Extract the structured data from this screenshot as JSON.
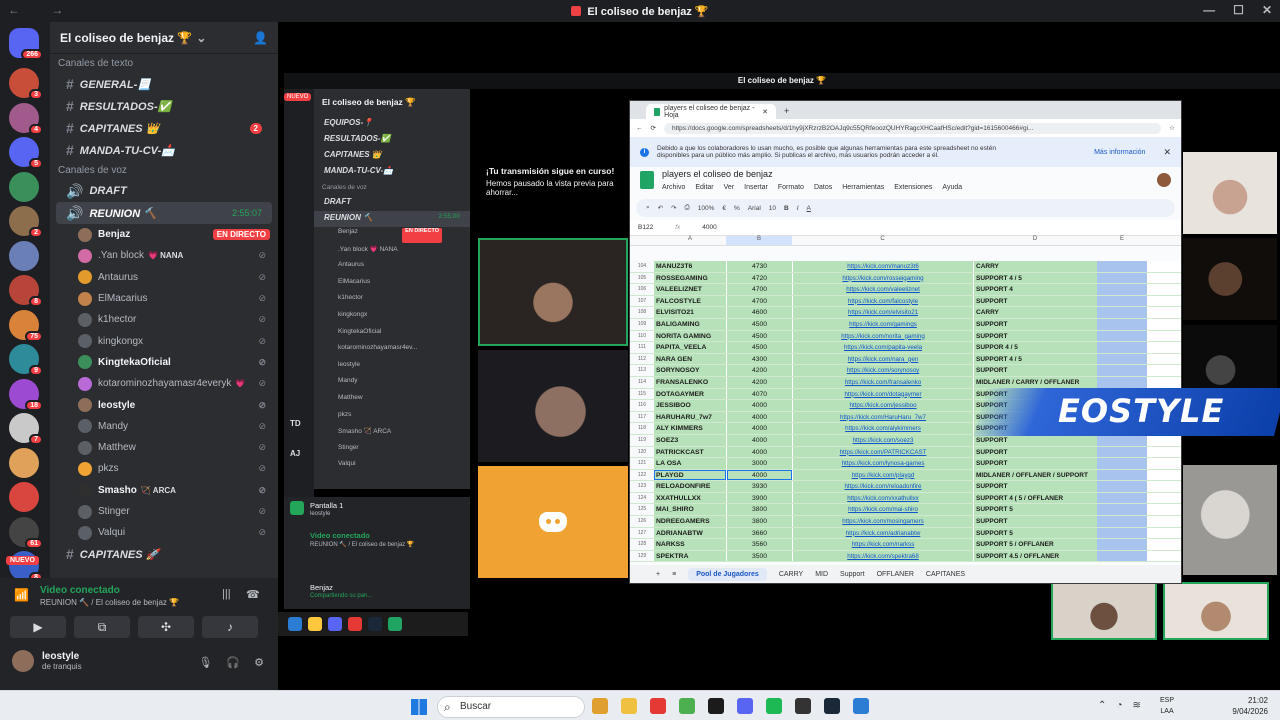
{
  "window": {
    "title": "El coliseo de benjaz 🏆",
    "controls": [
      "—",
      "☐",
      "✕"
    ]
  },
  "rail": {
    "mention_badge": "266",
    "new_badge": "NUEVO",
    "servers": [
      {
        "color": "#c94e3a",
        "badge": "3"
      },
      {
        "color": "#a05a8c",
        "badge": "4"
      },
      {
        "color": "#5865f2",
        "badge": "5"
      },
      {
        "color": "#3b8f5a",
        "badge": ""
      },
      {
        "color": "#8c6e4d",
        "badge": "2"
      },
      {
        "color": "#6a7fb5",
        "badge": ""
      },
      {
        "color": "#b8453a",
        "badge": "8"
      },
      {
        "color": "#d9833a",
        "badge": "75"
      },
      {
        "color": "#2e8b9a",
        "badge": "9"
      },
      {
        "color": "#9b4ad1",
        "badge": "18"
      },
      {
        "color": "#c9c9c9",
        "badge": "7"
      },
      {
        "color": "#e0a25a",
        "badge": ""
      },
      {
        "color": "#d9453f",
        "badge": ""
      },
      {
        "color": "#444",
        "badge": "61"
      },
      {
        "color": "#3a5fc7",
        "badge": "8"
      }
    ]
  },
  "sidebar": {
    "guild_name": "El coliseo de benjaz 🏆",
    "text_category": "Canales de texto",
    "text_channels": [
      {
        "name": "GENERAL-📃",
        "count": ""
      },
      {
        "name": "RESULTADOS-✅",
        "count": ""
      },
      {
        "name": "CAPITANES 👑",
        "count": "2"
      },
      {
        "name": "MANDA-TU-CV-📩",
        "count": ""
      }
    ],
    "voice_category": "Canales de voz",
    "voice_channels": [
      {
        "name": "DRAFT",
        "timer": ""
      },
      {
        "name": "REUNION 🔨",
        "timer": "2:55:07"
      }
    ],
    "voice_users": [
      {
        "name": "Benjaz",
        "tag": "",
        "live": "EN DIRECTO",
        "color": "#8e6e5b",
        "bright": true
      },
      {
        "name": ".Yan block",
        "tag": "💗 NANA",
        "live": "",
        "color": "#d26aa6",
        "bright": false
      },
      {
        "name": "Antaurus",
        "tag": "",
        "live": "",
        "color": "#e29b2b",
        "bright": false
      },
      {
        "name": "ElMacarius",
        "tag": "",
        "live": "",
        "color": "#c1824b",
        "bright": false
      },
      {
        "name": "k1hector",
        "tag": "",
        "live": "",
        "color": "#5b5f66",
        "bright": false
      },
      {
        "name": "kingkongx",
        "tag": "",
        "live": "",
        "color": "#5b5f66",
        "bright": false
      },
      {
        "name": "KingtekaOficial",
        "tag": "",
        "live": "",
        "color": "#3b8f5a",
        "bright": true
      },
      {
        "name": "kotarominozhayamasr4everyk",
        "tag": "💗",
        "live": "",
        "color": "#b86ad6",
        "bright": false
      },
      {
        "name": "leostyle",
        "tag": "",
        "live": "",
        "color": "#8e6e5b",
        "bright": true
      },
      {
        "name": "Mandy",
        "tag": "",
        "live": "",
        "color": "#5b5f66",
        "bright": false
      },
      {
        "name": "Matthew",
        "tag": "",
        "live": "",
        "color": "#5b5f66",
        "bright": false
      },
      {
        "name": "pkzs",
        "tag": "",
        "live": "",
        "color": "#f0a232",
        "bright": false
      },
      {
        "name": "Smasho",
        "tag": "🏹 ARCA",
        "live": "",
        "color": "#2f2f2f",
        "bright": true
      },
      {
        "name": "Stinger",
        "tag": "",
        "live": "",
        "color": "#5b5f66",
        "bright": false
      },
      {
        "name": "Valqui",
        "tag": "",
        "live": "",
        "color": "#5b5f66",
        "bright": false
      }
    ],
    "bottom_channel": "CAPITANES 🚀"
  },
  "voicebar": {
    "status": "Video conectado",
    "location": "REUNION 🔨 / El coliseo de benjaz 🏆",
    "username": "leostyle",
    "user_status": "de tranquis"
  },
  "stream": {
    "inner_title": "El coliseo de benjaz 🏆",
    "inner_msg_title": "¡Tu transmisión sigue en curso!",
    "inner_msg_body": "Hemos pausado la vista previa para ahorrar...",
    "inner_guild": "El coliseo de benjaz 🏆",
    "inner_channels": [
      "EQUIPOS-📍",
      "RESULTADOS-✅",
      "CAPITANES 👑",
      "MANDA-TU-CV-📩"
    ],
    "inner_new": "NUEVO",
    "inner_voice_cat": "Canales de voz",
    "inner_voice_channels": [
      "DRAFT",
      "REUNION 🔨"
    ],
    "inner_timer": "2:55:00",
    "inner_users": [
      "Benjaz",
      ".Yan block 💗 NANA",
      "Antaurus",
      "ElMacarius",
      "k1hector",
      "kingkongx",
      "KingtekaOficial",
      "kotarominozhayamasr4ev...",
      "leostyle",
      "Mandy",
      "Matthew",
      "pkzs",
      "Smasho 🏹 ARCA",
      "Stinger",
      "Valqui"
    ],
    "inner_live": "EN DIRECTO",
    "inner_screen": "Pantalla 1",
    "inner_screen_sub": "leostyle",
    "inner_conn": "Video conectado",
    "inner_conn_sub": "REUNION 🔨 / El coliseo de benjaz 🏆",
    "inner_user": "Benjaz",
    "inner_user_sub": "Compartiendo su pan...",
    "overlay": "EOSTYLE",
    "rail_labels": [
      "TD",
      "AJ"
    ]
  },
  "sheet": {
    "tab_title": "players el coliseo de benjaz - Hoja",
    "url": "https://docs.google.com/spreadsheets/d/1hy9jXRzrzB2OAJq9c55QRfeoozQUHYRagcXHCaafHSc/edit?gid=1615600466#gi...",
    "notice": "Debido a que los colaboradores lo usan mucho, es posible que algunas herramientas para este spreadsheet no estén disponibles para un público más amplio. Si publicas el archivo, más usuarios podrán acceder a él.",
    "notice_link": "Más información",
    "doc_title": "players el coliseo de benjaz",
    "menu": [
      "Archivo",
      "Editar",
      "Ver",
      "Insertar",
      "Formato",
      "Datos",
      "Herramientas",
      "Extensiones",
      "Ayuda"
    ],
    "zoom": "100%",
    "font": "Arial",
    "font_size": "10",
    "cell_ref": "B122",
    "formula_value": "4000",
    "columns": [
      "A",
      "B",
      "C",
      "D",
      "E"
    ],
    "rows": [
      {
        "n": "104",
        "name": "MANUZ3T6",
        "mmr": "4730",
        "link": "https://kick.com/manuz3t6",
        "role": "CARRY"
      },
      {
        "n": "105",
        "name": "ROSSEGAMING",
        "mmr": "4720",
        "link": "https://kick.com/rosseigaming",
        "role": "SUPPORT 4 / 5"
      },
      {
        "n": "106",
        "name": "VALEELIZNET",
        "mmr": "4700",
        "link": "https://kick.com/valeeliznet",
        "role": "SUPPORT 4"
      },
      {
        "n": "107",
        "name": "FALCOSTYLE",
        "mmr": "4700",
        "link": "https://kick.com/falcostyle",
        "role": "SUPPORT"
      },
      {
        "n": "108",
        "name": "ELVISITO21",
        "mmr": "4600",
        "link": "https://kick.com/elvisito21",
        "role": "CARRY"
      },
      {
        "n": "109",
        "name": "BALIGAMING",
        "mmr": "4500",
        "link": "https://kick.com/gamings",
        "role": "SUPPORT"
      },
      {
        "n": "110",
        "name": "NORITA GAMING",
        "mmr": "4500",
        "link": "https://kick.com/norita_gaming",
        "role": "SUPPORT"
      },
      {
        "n": "111",
        "name": "PAPITA_VEELA",
        "mmr": "4500",
        "link": "https://kick.com/papita-veela",
        "role": "SUPPOR 4 / 5"
      },
      {
        "n": "112",
        "name": "NARA GEN",
        "mmr": "4300",
        "link": "https://kick.com/nara_gen",
        "role": "SUPPORT 4 / 5"
      },
      {
        "n": "113",
        "name": "SORYNOSOY",
        "mmr": "4200",
        "link": "https://kick.com/sorynosoy",
        "role": "SUPPORT"
      },
      {
        "n": "114",
        "name": "FRANSALENKO",
        "mmr": "4200",
        "link": "https://kick.com/fransalenko",
        "role": "MIDLANER / CARRY / OFFLANER"
      },
      {
        "n": "115",
        "name": "DOTAGAYMER",
        "mmr": "4070",
        "link": "https://kick.com/dotagaymer",
        "role": "SUPPORT"
      },
      {
        "n": "116",
        "name": "JESSIBOO",
        "mmr": "4000",
        "link": "https://kick.com/jessiboo",
        "role": "SUPPORT"
      },
      {
        "n": "117",
        "name": "HARUHARU_7w7",
        "mmr": "4000",
        "link": "https://kick.com/HaruHaru_7w7",
        "role": "SUPPORT"
      },
      {
        "n": "118",
        "name": "ALY KIMMERS",
        "mmr": "4000",
        "link": "https://kick.com/alykimmers",
        "role": "SUPPORT"
      },
      {
        "n": "119",
        "name": "SOEZ3",
        "mmr": "4000",
        "link": "https://kick.com/soez3",
        "role": "SUPPORT"
      },
      {
        "n": "120",
        "name": "PATRICKCAST",
        "mmr": "4000",
        "link": "https://kick.com/PATRICKCAST",
        "role": "SUPPORT"
      },
      {
        "n": "121",
        "name": "LA OSA",
        "mmr": "3000",
        "link": "https://kick.com/lynosa-games",
        "role": "SUPPORT"
      },
      {
        "n": "122",
        "name": "PLAYGD",
        "mmr": "4000",
        "link": "https://kick.com/playgd",
        "role": "MIDLANER / OFFLANER / SUPPORT"
      },
      {
        "n": "123",
        "name": "RELOADONFIRE",
        "mmr": "3930",
        "link": "https://kick.com/reloadonfire",
        "role": "SUPPORT"
      },
      {
        "n": "124",
        "name": "XXATHULLXX",
        "mmr": "3900",
        "link": "https://kick.com/xxathullxx",
        "role": "SUPPORT 4 ( 5 / OFFLANER"
      },
      {
        "n": "125",
        "name": "MAI_SHIRO",
        "mmr": "3800",
        "link": "https://kick.com/mai-shiro",
        "role": "SUPPORT 5"
      },
      {
        "n": "126",
        "name": "NDREEGAMERS",
        "mmr": "3800",
        "link": "https://kick.com/mosingamers",
        "role": "SUPPORT"
      },
      {
        "n": "127",
        "name": "ADRIANABTW",
        "mmr": "3660",
        "link": "https://kick.com/adrianabtw",
        "role": "SUPPORT 5"
      },
      {
        "n": "128",
        "name": "NARKSS",
        "mmr": "3560",
        "link": "https://kick.com/narkss",
        "role": "SUPPORT 5 / OFFLANER"
      },
      {
        "n": "129",
        "name": "SPEKTRA",
        "mmr": "3500",
        "link": "https://kick.com/spektra68",
        "role": "SUPPORT 4.5 / OFFLANER"
      }
    ],
    "sheet_tabs": [
      "Pool de Jugadores",
      "CARRY",
      "MID",
      "Support",
      "OFFLANER",
      "CAPITANES"
    ]
  },
  "taskbar": {
    "search": "Buscar",
    "lang1": "ESP",
    "lang2": "LAA",
    "time": "21:02",
    "date": "9/04/2026",
    "apps": [
      "#e0a030",
      "#f0c040",
      "#e53935",
      "#4caf50",
      "#1b1b1b",
      "#5865f2",
      "#1db954",
      "#333",
      "#1b2838",
      "#2b7cd3"
    ]
  }
}
